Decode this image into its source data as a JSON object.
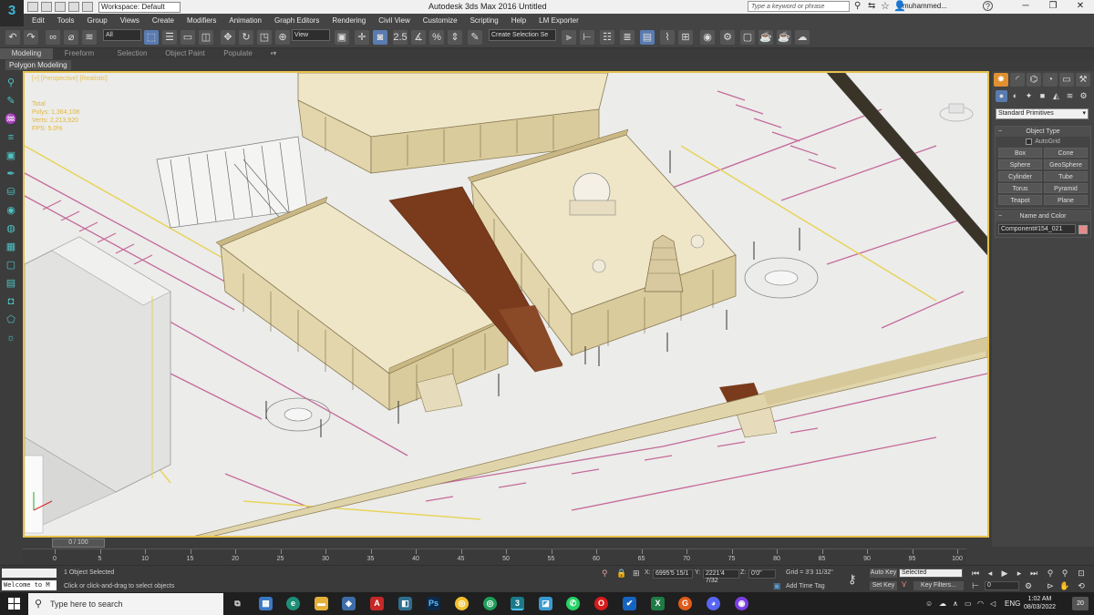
{
  "titlebar": {
    "workspace": "Workspace: Default",
    "title": "Autodesk 3ds Max 2016    Untitled",
    "search_placeholder": "Type a keyword or phrase",
    "user": "muhammed..."
  },
  "menu": [
    "Edit",
    "Tools",
    "Group",
    "Views",
    "Create",
    "Modifiers",
    "Animation",
    "Graph Editors",
    "Rendering",
    "Civil View",
    "Customize",
    "Scripting",
    "Help",
    "LM Exporter"
  ],
  "toolbar": {
    "selection_filter": "All",
    "ref_coord": "View",
    "create_selection_set": "Create Selection Se",
    "snap_value": "2.5"
  },
  "ribbon": {
    "tabs": [
      "Modeling",
      "Freeform",
      "Selection",
      "Object Paint",
      "Populate"
    ],
    "active_tab": "Modeling",
    "sub_label": "Polygon Modeling"
  },
  "viewport": {
    "label": "[+] [Perspective] [Realistic]",
    "stats": [
      "Total",
      "Polys: 1,364,108",
      "Verts: 2,213,920",
      "FPS: 5.0%"
    ]
  },
  "command_panel": {
    "category": "Standard Primitives",
    "object_type_title": "Object Type",
    "autogrid": "AutoGrid",
    "buttons": [
      "Box",
      "Cone",
      "Sphere",
      "GeoSphere",
      "Cylinder",
      "Tube",
      "Torus",
      "Pyramid",
      "Teapot",
      "Plane"
    ],
    "name_color_title": "Name and Color",
    "object_name": "Component#154_021",
    "color": "#e88a8a"
  },
  "timeline": {
    "slider_label": "0 / 100",
    "ticks": [
      "0",
      "5",
      "10",
      "15",
      "20",
      "25",
      "30",
      "35",
      "40",
      "45",
      "50",
      "55",
      "60",
      "65",
      "70",
      "75",
      "80",
      "85",
      "90",
      "95",
      "100"
    ]
  },
  "status": {
    "welcome": "Welcome to M",
    "selected": "1 Object Selected",
    "prompt": "Click or click-and-drag to select objects",
    "x": "6995'5 15/1",
    "y": "2221'4 7/32",
    "z": "0'0\"",
    "grid": "Grid = 3'3 11/32\"",
    "auto_key": "Auto Key",
    "key_mode": "Selected",
    "set_key": "Set Key",
    "key_filters": "Key Filters...",
    "add_time_tag": "Add Time Tag",
    "frame": "0"
  },
  "taskbar": {
    "search": "Type here to search",
    "lang": "ENG",
    "time": "1:02 AM",
    "date": "08/03/2022",
    "notifications": "20"
  },
  "colors": {
    "viewport_border": "#e6c14a",
    "accent": "#3db8d8",
    "building": "#ece3c8"
  }
}
